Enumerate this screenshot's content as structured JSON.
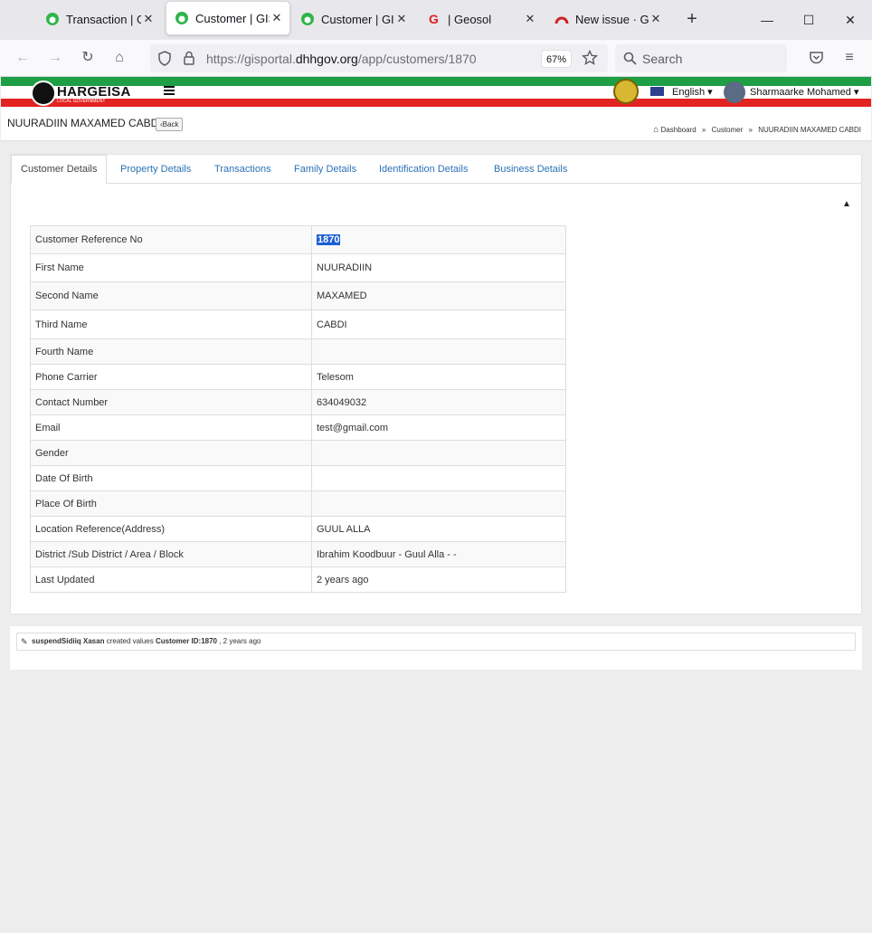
{
  "browser": {
    "tabs": [
      {
        "title": "Transaction | GIS",
        "favicon": "gis-leaf-icon"
      },
      {
        "title": "Customer | GIS",
        "favicon": "gis-leaf-icon"
      },
      {
        "title": "Customer | GIS",
        "favicon": "gis-leaf-icon"
      },
      {
        "title": "| Geosol",
        "favicon": "google-g-icon"
      },
      {
        "title": "New issue · GIS",
        "favicon": "redmine-icon"
      }
    ],
    "url_prefix": "https://gisportal.",
    "url_domain": "dhhgov.org",
    "url_path": "/app/customers/1870",
    "zoom": "67%",
    "search_placeholder": "Search"
  },
  "header": {
    "brand": "HARGEISA",
    "brand_sub": "LOCAL GOVERNMENT",
    "language": "English",
    "user": "Sharmaarke Mohamed"
  },
  "page": {
    "title": "NUURADIIN MAXAMED CABDI",
    "back_label": "Back",
    "breadcrumbs": [
      "Dashboard",
      "Customer",
      "NUURADIIN MAXAMED CABDI"
    ]
  },
  "tabs": [
    "Customer Details",
    "Property Details",
    "Transactions",
    "Family Details",
    "Identification Details",
    "Business Details"
  ],
  "details": [
    {
      "label": "Customer Reference No",
      "value": "1870"
    },
    {
      "label": "First Name",
      "value": "NUURADIIN"
    },
    {
      "label": "Second Name",
      "value": "MAXAMED"
    },
    {
      "label": "Third Name",
      "value": "CABDI"
    },
    {
      "label": "Fourth Name",
      "value": ""
    },
    {
      "label": "Phone Carrier",
      "value": "Telesom"
    },
    {
      "label": "Contact Number",
      "value": "634049032"
    },
    {
      "label": "Email",
      "value": "test@gmail.com"
    },
    {
      "label": "Gender",
      "value": ""
    },
    {
      "label": "Date Of Birth",
      "value": ""
    },
    {
      "label": "Place Of Birth",
      "value": ""
    },
    {
      "label": "Location Reference(Address)",
      "value": "GUUL ALLA"
    },
    {
      "label": "District /Sub District / Area / Block",
      "value": "Ibrahim Koodbuur - Guul Alla - -"
    },
    {
      "label": "Last Updated",
      "value": "2 years ago"
    }
  ],
  "activity": {
    "user": "suspendSidiiq Xasan",
    "action": "created values",
    "target": "Customer ID:1870",
    "time": ", 2 years ago"
  }
}
